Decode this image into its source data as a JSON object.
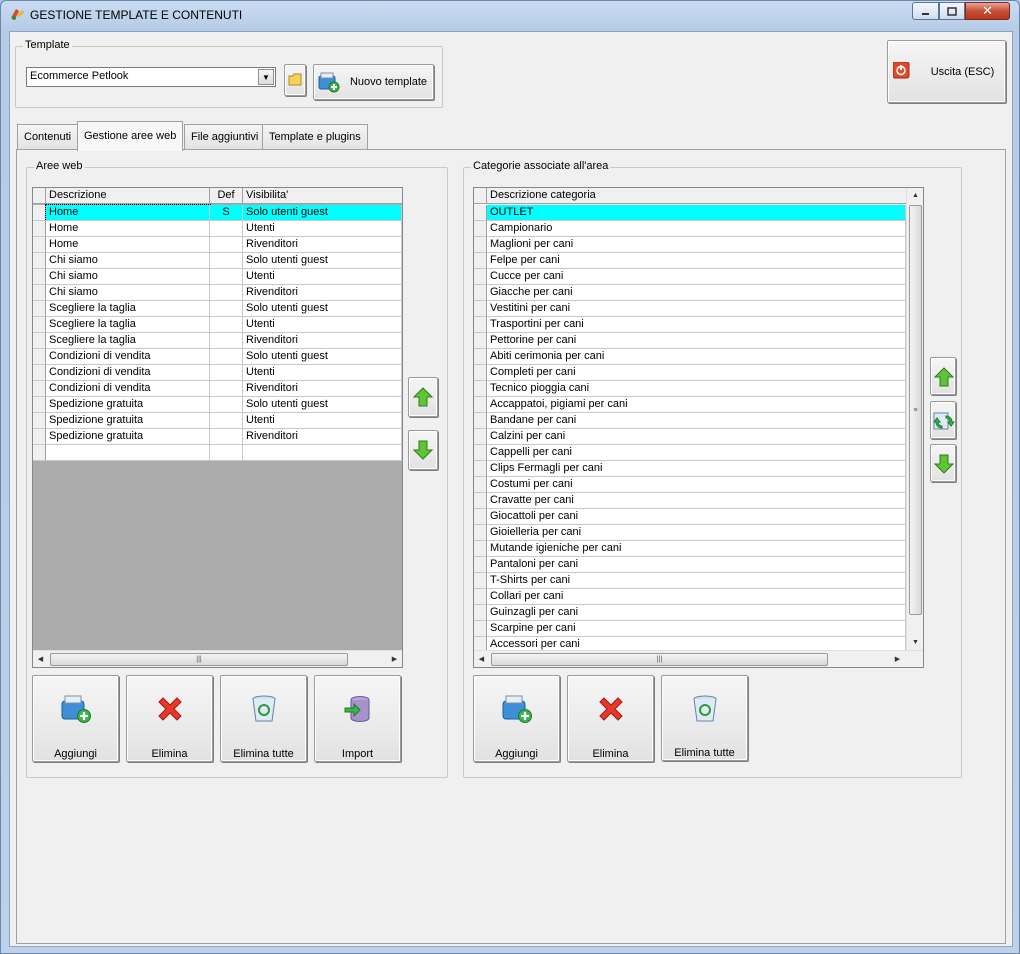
{
  "window": {
    "title": "GESTIONE TEMPLATE E CONTENUTI"
  },
  "template_group": {
    "title": "Template",
    "selected": "Ecommerce Petlook",
    "new_template_label": "Nuovo template"
  },
  "exit_button": {
    "label": "Uscita (ESC)"
  },
  "tabs": [
    {
      "label": "Contenuti"
    },
    {
      "label": "Gestione aree web"
    },
    {
      "label": "File aggiuntivi"
    },
    {
      "label": "Template e plugins"
    }
  ],
  "aree_web": {
    "title": "Aree web",
    "columns": [
      "Descrizione",
      "Def",
      "Visibilita'"
    ],
    "rows": [
      {
        "descrizione": "Home",
        "def": "S",
        "visibilita": "Solo utenti guest"
      },
      {
        "descrizione": "Home",
        "def": "",
        "visibilita": "Utenti"
      },
      {
        "descrizione": "Home",
        "def": "",
        "visibilita": "Rivenditori"
      },
      {
        "descrizione": "Chi siamo",
        "def": "",
        "visibilita": "Solo utenti guest"
      },
      {
        "descrizione": "Chi siamo",
        "def": "",
        "visibilita": "Utenti"
      },
      {
        "descrizione": "Chi siamo",
        "def": "",
        "visibilita": "Rivenditori"
      },
      {
        "descrizione": "Scegliere la taglia",
        "def": "",
        "visibilita": "Solo utenti guest"
      },
      {
        "descrizione": "Scegliere la taglia",
        "def": "",
        "visibilita": "Utenti"
      },
      {
        "descrizione": "Scegliere la taglia",
        "def": "",
        "visibilita": "Rivenditori"
      },
      {
        "descrizione": "Condizioni di vendita",
        "def": "",
        "visibilita": "Solo utenti guest"
      },
      {
        "descrizione": "Condizioni di vendita",
        "def": "",
        "visibilita": "Utenti"
      },
      {
        "descrizione": "Condizioni di vendita",
        "def": "",
        "visibilita": "Rivenditori"
      },
      {
        "descrizione": "Spedizione gratuita",
        "def": "",
        "visibilita": "Solo utenti guest"
      },
      {
        "descrizione": "Spedizione gratuita",
        "def": "",
        "visibilita": "Utenti"
      },
      {
        "descrizione": "Spedizione gratuita",
        "def": "",
        "visibilita": "Rivenditori"
      },
      {
        "descrizione": "",
        "def": "",
        "visibilita": ""
      }
    ],
    "buttons": {
      "aggiungi": "Aggiungi",
      "elimina": "Elimina",
      "elimina_tutte": "Elimina tutte",
      "import": "Import"
    }
  },
  "categorie": {
    "title": "Categorie associate all'area",
    "column": "Descrizione categoria",
    "rows": [
      "OUTLET",
      "Campionario",
      "Maglioni per cani",
      "Felpe per cani",
      "Cucce per cani",
      "Giacche per cani",
      "Vestitini per cani",
      "Trasportini per cani",
      "Pettorine per cani",
      "Abiti cerimonia per cani",
      "Completi per cani",
      "Tecnico pioggia cani",
      "Accappatoi, pigiami per cani",
      "Bandane per cani",
      "Calzini per cani",
      "Cappelli per cani",
      "Clips Fermagli per cani",
      "Costumi per cani",
      "Cravatte per cani",
      "Giocattoli per cani",
      "Gioielleria per cani",
      "Mutande igieniche per cani",
      "Pantaloni per cani",
      "T-Shirts per cani",
      "Collari per cani",
      "Guinzagli per cani",
      "Scarpine per cani",
      "Accessori per cani"
    ],
    "buttons": {
      "aggiungi": "Aggiungi",
      "elimina": "Elimina",
      "elimina_tutte": "Elimina tutte"
    }
  },
  "colors": {
    "selection": "#00ffff",
    "grid_empty": "#ababab"
  }
}
